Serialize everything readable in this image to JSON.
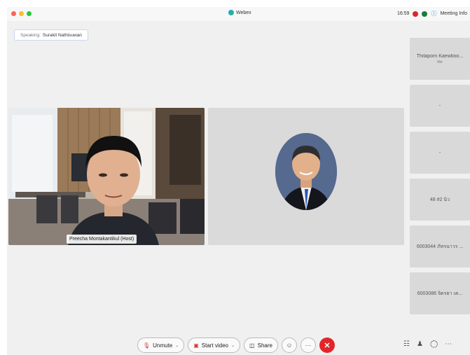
{
  "window": {
    "app_title": "Webex",
    "clock": "16:59",
    "meeting_info_label": "Meeting Info"
  },
  "speaking": {
    "label": "Speaking:",
    "name": "Surakit Nathisuwan"
  },
  "main_tile": {
    "host_label": "Preecha Montakantikul  (Host)"
  },
  "sidebar": {
    "tiles": [
      {
        "name": "Thitaporn Kaewboo...",
        "sub": "Me"
      },
      {
        "name": "-",
        "sub": ""
      },
      {
        "name": "-",
        "sub": ""
      },
      {
        "name": "48 #2 นิว",
        "sub": ""
      },
      {
        "name": "6003044 ภัทรนาวร ...",
        "sub": ""
      },
      {
        "name": "6003086 จิตรยา เค...",
        "sub": ""
      }
    ]
  },
  "toolbar": {
    "unmute_label": "Unmute",
    "start_video_label": "Start video",
    "share_label": "Share"
  },
  "colors": {
    "end_call": "#e0262a",
    "accent": "#1d6fd9"
  }
}
